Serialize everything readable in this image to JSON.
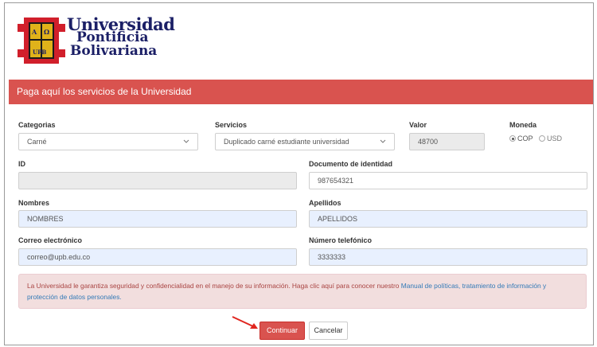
{
  "header": {
    "logo_line1": "Universidad",
    "logo_line2": "Pontificia",
    "logo_line3": "Bolivariana",
    "shield_top": "A Ω",
    "shield_bottom": "UPB",
    "banner": "Paga aquí los servicios de la Universidad"
  },
  "form": {
    "categorias": {
      "label": "Categorias",
      "value": "Carné"
    },
    "servicios": {
      "label": "Servicios",
      "value": "Duplicado carné estudiante universidad"
    },
    "valor": {
      "label": "Valor",
      "value": "48700"
    },
    "moneda": {
      "label": "Moneda",
      "options": [
        {
          "label": "COP",
          "selected": true
        },
        {
          "label": "USD",
          "selected": false
        }
      ]
    },
    "id": {
      "label": "ID",
      "value": ""
    },
    "documento": {
      "label": "Documento de identidad",
      "value": "987654321"
    },
    "nombres": {
      "label": "Nombres",
      "value": "NOMBRES"
    },
    "apellidos": {
      "label": "Apellidos",
      "value": "APELLIDOS"
    },
    "correo": {
      "label": "Correo electrónico",
      "value": "correo@upb.edu.co"
    },
    "telefono": {
      "label": "Número telefónico",
      "value": "3333333"
    }
  },
  "alert": {
    "text": "La Universidad le garantiza seguridad y confidencialidad en el manejo de su información. Haga clic aquí para conocer nuestro ",
    "link": "Manual de políticas, tratamiento de información y protección de datos personales."
  },
  "actions": {
    "continue_label": "Continuar",
    "cancel_label": "Cancelar"
  },
  "colors": {
    "banner": "#d9534f",
    "primary_button": "#d9534f",
    "alert_bg": "#f2dede",
    "alert_text": "#a94442",
    "link": "#337ab7",
    "autofill_bg": "#e8f0fe",
    "logo_text": "#1b1f66"
  },
  "icons": {
    "chevron": "chevron-down-icon",
    "shield": "upb-shield-logo",
    "arrow": "red-arrow-annotation"
  }
}
